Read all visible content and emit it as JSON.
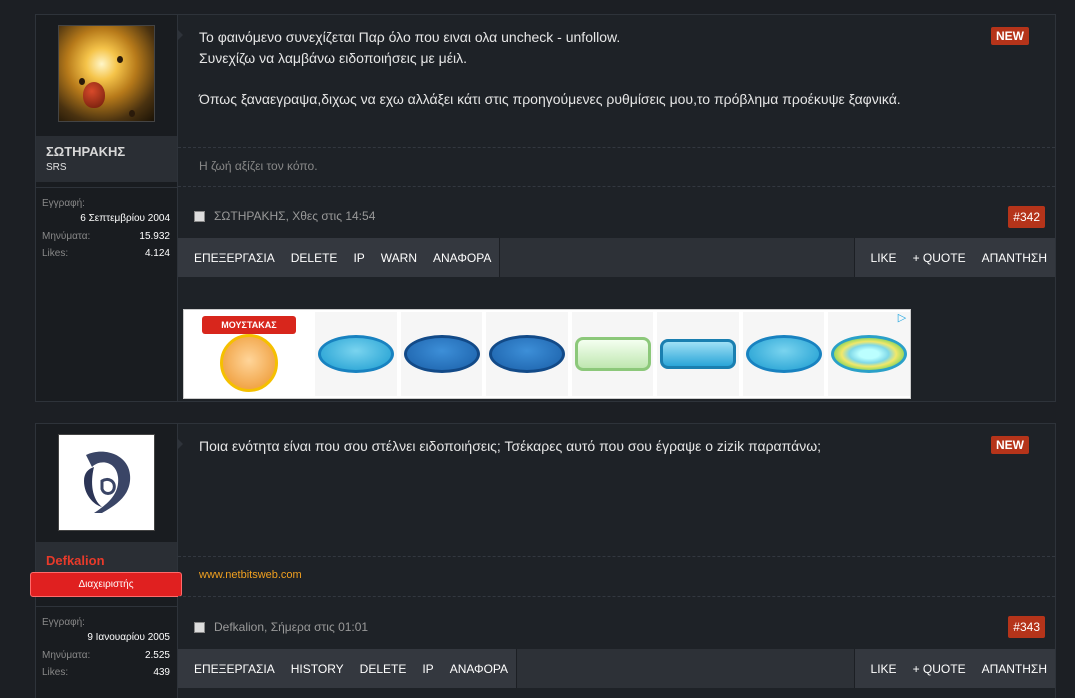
{
  "posts": [
    {
      "username": "ΣΩΤΗΡΑΚΗΣ",
      "usertitle": "SRS",
      "stats": {
        "join_label": "Εγγραφή:",
        "join_date": "6 Σεπτεμβρίου 2004",
        "messages_label": "Μηνύματα:",
        "messages_value": "15.932",
        "likes_label": "Likes:",
        "likes_value": "4.124"
      },
      "new_badge": "NEW",
      "message_lines": [
        "Το φαινόμενο συνεχίζεται Παρ όλο που ειναι ολα uncheck - unfollow.",
        "Συνεχίζω να λαμβάνω ειδοποιήσεις με μέιλ.",
        "",
        "Όπως ξαναεγραψα,διχως να εχω αλλάξει κάτι στις προηγούμενες ρυθμίσεις μου,το πρόβλημα προέκυψε ξαφνικά."
      ],
      "signature": "Η ζωή αξίζει τον κόπο.",
      "postinfo": "ΣΩΤΗΡΑΚΗΣ, Χθες στις 14:54",
      "post_number": "#342",
      "actions_left": [
        "ΕΠΕΞΕΡΓΑΣΙΑ",
        "DELETE",
        "IP",
        "WARN",
        "ΑΝΑΦΟΡΑ"
      ],
      "actions_right": [
        "LIKE",
        "+ QUOTE",
        "ΑΠΑΝΤΗΣΗ"
      ],
      "ad": {
        "brand": "ΜΟΥΣΤΑΚΑΣ",
        "choice_icon": "ad-choices-icon"
      }
    },
    {
      "username": "Defkalion",
      "role": "Διαχειριστής",
      "stats": {
        "join_label": "Εγγραφή:",
        "join_date": "9 Ιανουαρίου 2005",
        "messages_label": "Μηνύματα:",
        "messages_value": "2.525",
        "likes_label": "Likes:",
        "likes_value": "439"
      },
      "new_badge": "NEW",
      "message_lines": [
        "Ποια ενότητα είναι που σου στέλνει ειδοποιήσεις; Τσέκαρες αυτό που σου έγραψε ο zizik παραπάνω;"
      ],
      "signature": "www.netbitsweb.com",
      "postinfo": "Defkalion, Σήμερα στις 01:01",
      "post_number": "#343",
      "actions_left": [
        "ΕΠΕΞΕΡΓΑΣΙΑ",
        "HISTORY",
        "DELETE",
        "IP",
        "ΑΝΑΦΟΡΑ"
      ],
      "actions_right": [
        "LIKE",
        "+ QUOTE",
        "ΑΠΑΝΤΗΣΗ"
      ]
    }
  ],
  "colors": {
    "accent_badge": "#b5341a",
    "admin_red": "#e02020",
    "signature_link": "#f0a020"
  }
}
